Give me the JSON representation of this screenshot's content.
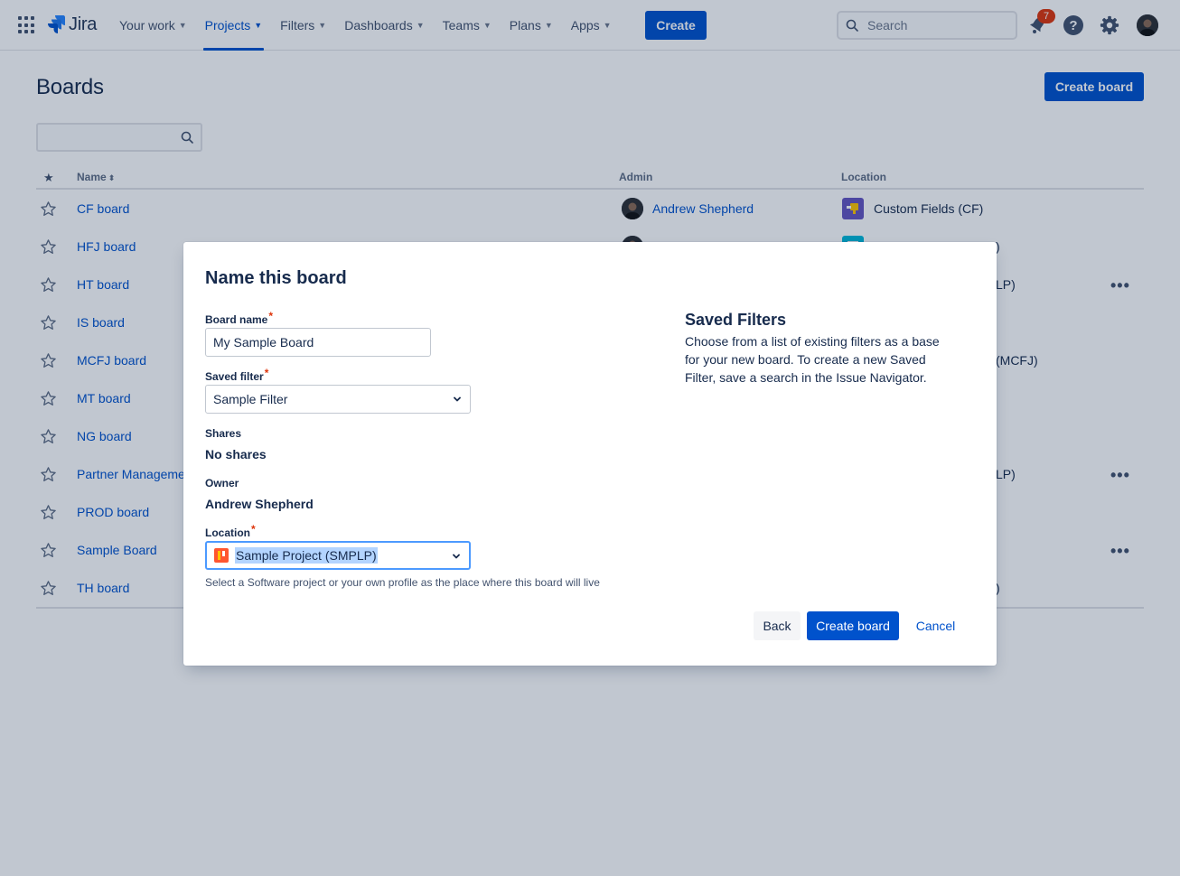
{
  "nav": {
    "logo_text": "Jira",
    "items": [
      {
        "label": "Your work"
      },
      {
        "label": "Projects"
      },
      {
        "label": "Filters"
      },
      {
        "label": "Dashboards"
      },
      {
        "label": "Teams"
      },
      {
        "label": "Plans"
      },
      {
        "label": "Apps"
      }
    ],
    "active_item": "Projects",
    "create_label": "Create",
    "search_placeholder": "Search",
    "notification_count": "7",
    "help_glyph": "?",
    "icons": [
      "app-switcher-icon",
      "jira-logo-icon",
      "search-icon",
      "notification-bell-icon",
      "help-icon",
      "settings-gear-icon",
      "user-avatar"
    ]
  },
  "page": {
    "title": "Boards",
    "create_board_label": "Create board",
    "filter_value": ""
  },
  "table": {
    "headers": {
      "star": "★",
      "name": "Name",
      "sort_glyph": "⬍",
      "admin": "Admin",
      "location": "Location"
    },
    "rows": [
      {
        "name": "CF board",
        "admin": "Andrew Shepherd",
        "location": "Custom Fields (CF)",
        "more": false
      },
      {
        "name": "HFJ board",
        "admin": "",
        "location": ")",
        "more": false
      },
      {
        "name": "HT board",
        "admin": "",
        "location": "LP)",
        "more": true
      },
      {
        "name": "IS board",
        "admin": "",
        "location": "",
        "more": false
      },
      {
        "name": "MCFJ board",
        "admin": "",
        "location": "(MCFJ)",
        "more": false
      },
      {
        "name": "MT board",
        "admin": "",
        "location": "",
        "more": false
      },
      {
        "name": "NG board",
        "admin": "",
        "location": "",
        "more": false
      },
      {
        "name": "Partner Manageme",
        "admin": "",
        "location": "LP)",
        "more": true
      },
      {
        "name": "PROD board",
        "admin": "",
        "location": "",
        "more": false
      },
      {
        "name": "Sample Board",
        "admin": "",
        "location": "",
        "more": true
      },
      {
        "name": "TH board",
        "admin": "",
        "location": ")",
        "more": false
      }
    ],
    "more_glyph": "•••"
  },
  "modal": {
    "title": "Name this board",
    "board_name_label": "Board name",
    "board_name_value": "My Sample Board",
    "saved_filter_label": "Saved filter",
    "saved_filter_value": "Sample Filter",
    "shares_label": "Shares",
    "shares_value": "No shares",
    "owner_label": "Owner",
    "owner_value": "Andrew Shepherd",
    "location_label": "Location",
    "location_value": "Sample Project (SMPLP)",
    "location_hint": "Select a Software project or your own profile as the place where this board will live",
    "required_marker": "*",
    "side_title": "Saved Filters",
    "side_desc": "Choose from a list of existing filters as a base for your new board. To create a new Saved Filter, save a search in the Issue Navigator.",
    "back_label": "Back",
    "create_label": "Create board",
    "cancel_label": "Cancel"
  },
  "colors": {
    "brand": "#0052cc",
    "text": "#172b4d",
    "focus_ring": "#4c9aff",
    "required": "#de350b",
    "badge": "#de350b"
  }
}
